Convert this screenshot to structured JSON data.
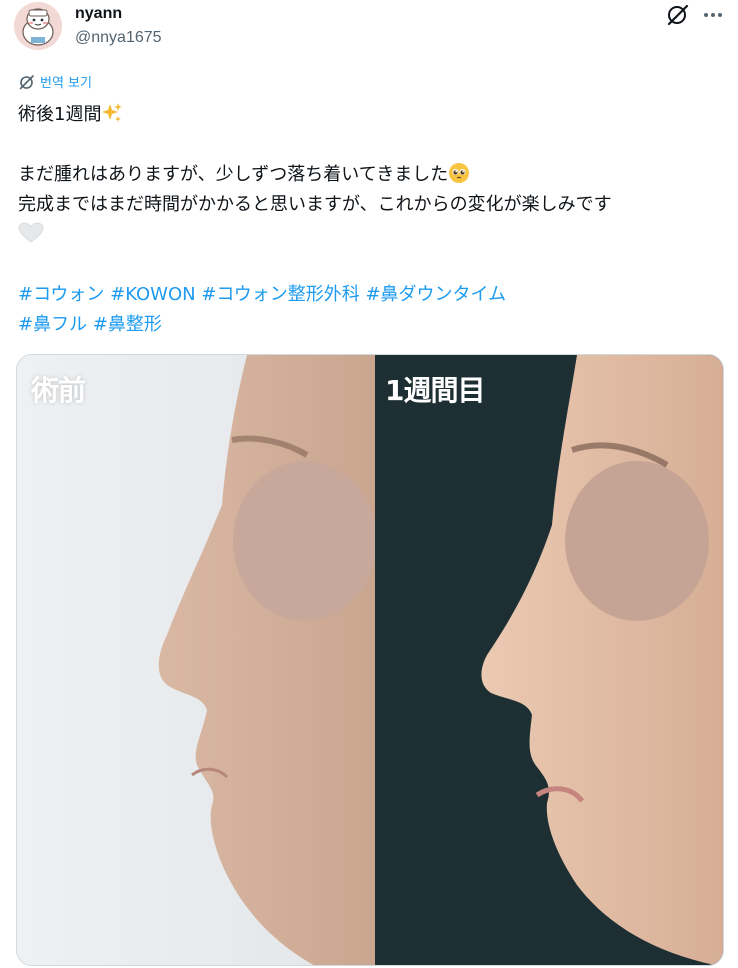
{
  "author": {
    "name": "nyann",
    "handle": "@nnya1675"
  },
  "icons": {
    "grok": "grok-icon",
    "more": "more-icon",
    "translate": "translate-icon"
  },
  "translate_label": "번역 보기",
  "tweet": {
    "title": "術後1週間",
    "line1": "まだ腫れはありますが、少しずつ落ち着いてきました",
    "line2": "完成まではまだ時間がかかると思いますが、これからの変化が楽しみです",
    "hashtags_row1": [
      "#コウォン",
      "#KOWON",
      "#コウォン整形外科",
      "#鼻ダウンタイム"
    ],
    "hashtags_row2": [
      "#鼻フル",
      "#鼻整形"
    ]
  },
  "media": {
    "left_label": "術前",
    "right_label": "1週間目"
  },
  "colors": {
    "accent": "#1d9bf0",
    "text": "#0f1419",
    "secondary": "#536471",
    "border": "#cfd9de"
  }
}
